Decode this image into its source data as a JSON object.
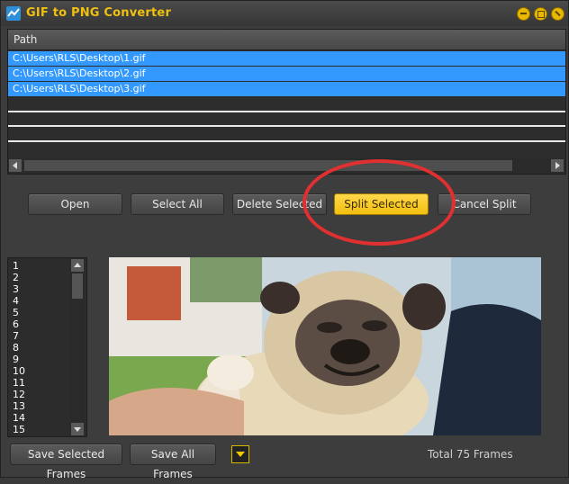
{
  "window": {
    "title": "GIF to PNG Converter",
    "controls": [
      "minimize-icon",
      "maximize-icon",
      "close-icon"
    ]
  },
  "file_list": {
    "header": "Path",
    "files": [
      "C:\\Users\\RLS\\Desktop\\1.gif",
      "C:\\Users\\RLS\\Desktop\\2.gif",
      "C:\\Users\\RLS\\Desktop\\3.gif"
    ]
  },
  "buttons": {
    "open": "Open",
    "select_all": "Select All",
    "delete_selected": "Delete Selected",
    "split_selected": "Split Selected",
    "cancel_split": "Cancel Split"
  },
  "frames": {
    "items": [
      "1",
      "2",
      "3",
      "4",
      "5",
      "6",
      "7",
      "8",
      "9",
      "10",
      "11",
      "12",
      "13",
      "14",
      "15"
    ]
  },
  "bottom": {
    "save_selected": "Save Selected Frames",
    "save_all": "Save All Frames",
    "total": "Total 75 Frames"
  },
  "colors": {
    "accent": "#f0c010",
    "selection": "#3399ff",
    "highlight_ring": "#e03030"
  }
}
